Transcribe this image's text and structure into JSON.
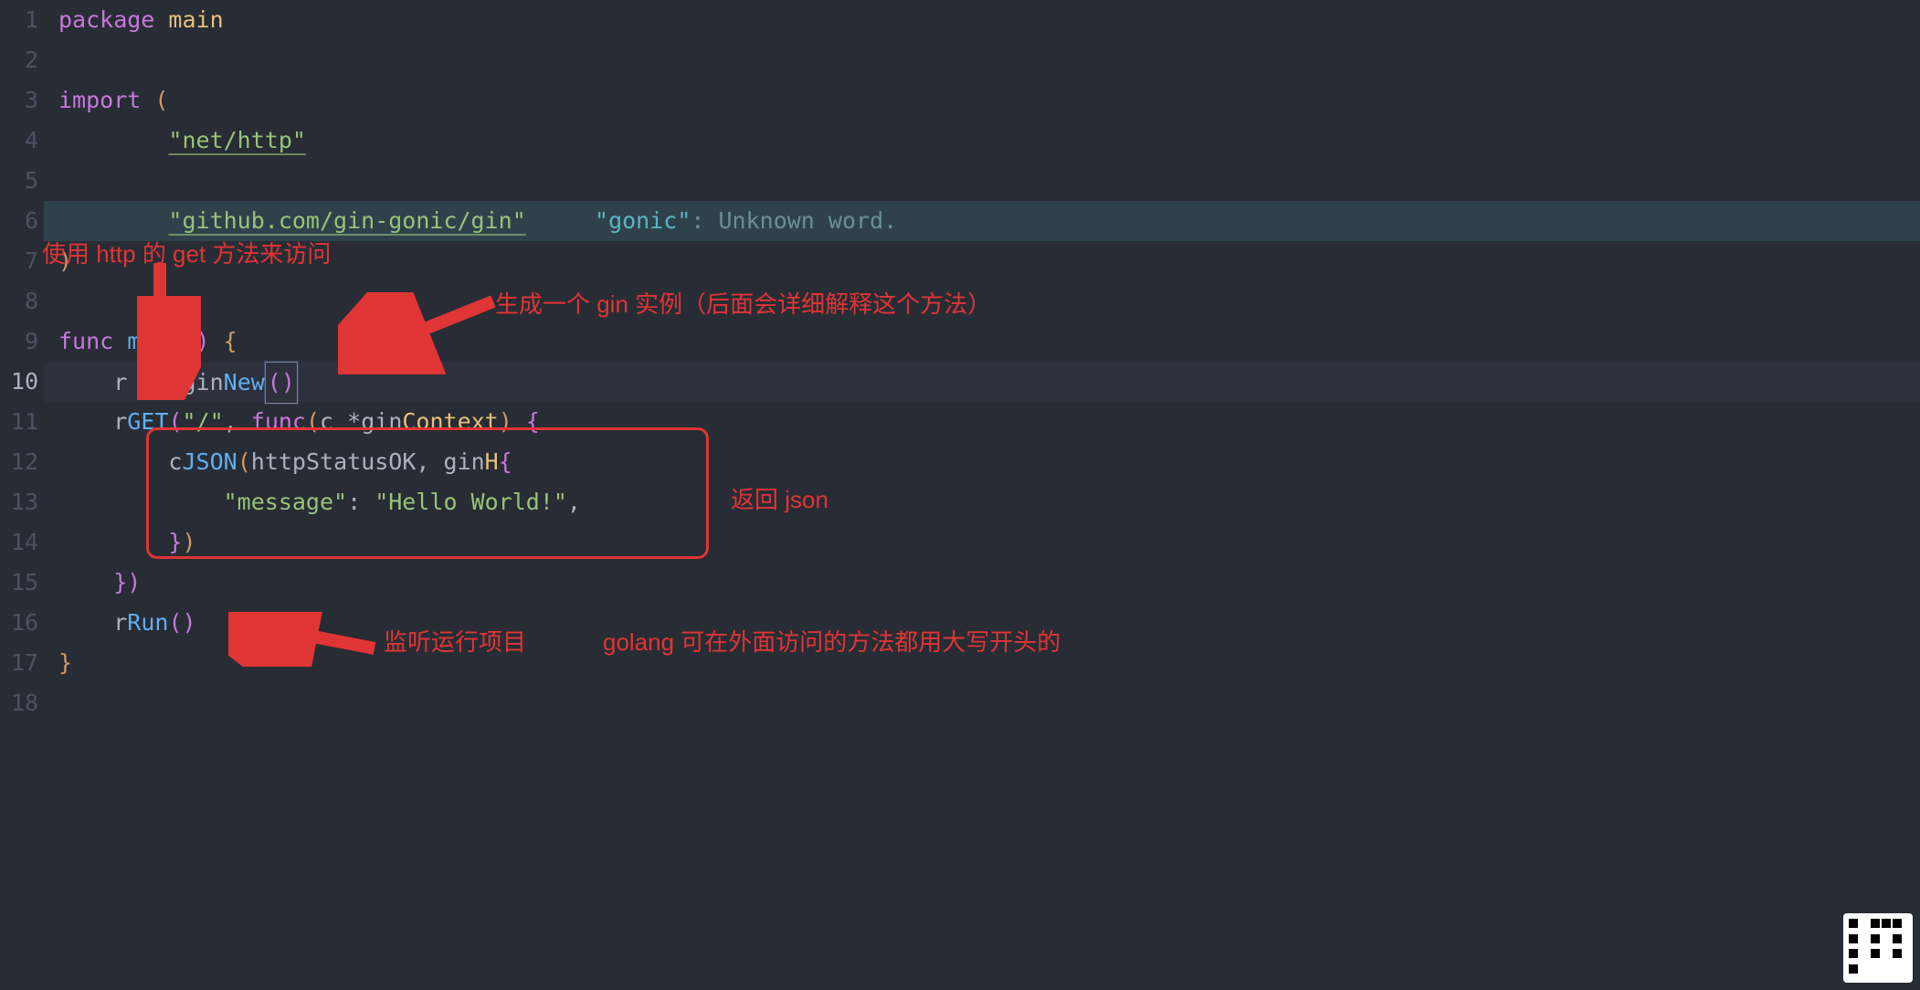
{
  "lines": [
    "1",
    "2",
    "3",
    "4",
    "5",
    "6",
    "7",
    "8",
    "9",
    "10",
    "11",
    "12",
    "13",
    "14",
    "15",
    "16",
    "17",
    "18"
  ],
  "currentLine": "10",
  "code": {
    "l1": {
      "kw": "package",
      "sp": " ",
      "name": "main"
    },
    "l3": {
      "kw": "import",
      "sp": " ",
      "paren": "("
    },
    "l4": {
      "indent": "        ",
      "str": "\"net/http\""
    },
    "l6": {
      "indent": "        ",
      "str": "\"github.com/gin-gonic/gin\"",
      "gap": "     ",
      "hint_q": "\"gonic\"",
      "hint_c": ": ",
      "hint_t": "Unknown word."
    },
    "l7": {
      "paren": ")"
    },
    "l9": {
      "kw": "func",
      "sp": " ",
      "name": "main",
      "parens": "()",
      "sp2": " ",
      "brace": "{"
    },
    "l10": {
      "indent": "    ",
      "r": "r ",
      ":=": ":= ",
      "gin": "gin",
      ".": ".",
      "New": "New",
      "p": "()"
    },
    "l11": {
      "indent": "    ",
      "r": "r",
      ".": ".",
      "GET": "GET",
      "po": "(",
      "s": "\"/\"",
      "c": ", ",
      "kw": "func",
      "po2": "(",
      "c2": "c ",
      "star": "*",
      "gin": "gin",
      ".2": ".",
      "ctx": "Context",
      "pc": ")",
      " ": " ",
      "brace": "{"
    },
    "l12": {
      "indent": "        ",
      "c": "c",
      ".": ".",
      "JSON": "JSON",
      "po": "(",
      "http": "http",
      ".2": ".",
      "sk": "StatusOK",
      "c2": ", ",
      "gin": "gin",
      ".3": ".",
      "H": "H",
      "brace": "{"
    },
    "l13": {
      "indent": "            ",
      "k": "\"message\"",
      "colon": ": ",
      "v": "\"Hello World!\"",
      "comma": ","
    },
    "l14": {
      "indent": "        ",
      "brace": "}",
      "paren": ")"
    },
    "l15": {
      "indent": "    ",
      "brace": "}",
      "paren": ")"
    },
    "l16": {
      "indent": "    ",
      "r": "r",
      ".": ".",
      "Run": "Run",
      "p": "()"
    },
    "l17": {
      "brace": "}"
    }
  },
  "annotations": {
    "a1": "使用 http 的 get 方法来访问",
    "a2": "生成一个 gin 实例（后面会详细解释这个方法）",
    "a3": "返回 json",
    "a4": "监听运行项目",
    "a5": "golang 可在外面访问的方法都用大写开头的"
  }
}
